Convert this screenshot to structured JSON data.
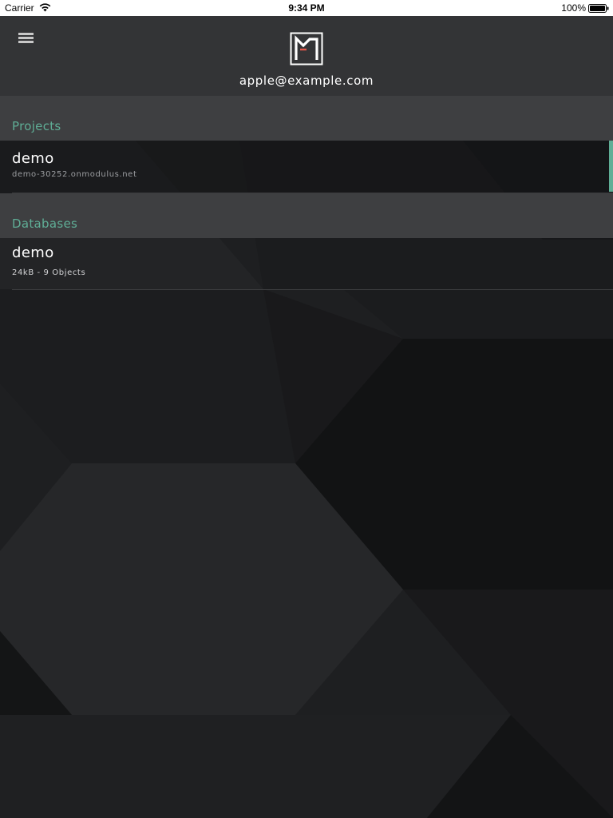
{
  "status_bar": {
    "carrier": "Carrier",
    "time": "9:34 PM",
    "battery": "100%"
  },
  "header": {
    "logo": "modulus-logo",
    "email": "apple@example.com"
  },
  "sections": {
    "projects": {
      "title": "Projects",
      "items": [
        {
          "name": "demo",
          "subtitle": "demo-30252.onmodulus.net",
          "selected": true
        }
      ]
    },
    "databases": {
      "title": "Databases",
      "items": [
        {
          "name": "demo",
          "subtitle": "24kB - 9 Objects"
        }
      ]
    }
  },
  "icons": {
    "menu": "hamburger-menu-icon",
    "wifi": "wifi-icon",
    "battery": "battery-icon"
  },
  "colors": {
    "accent": "#5fae96",
    "header_bg": "#333436",
    "section_bg": "#3e3f41",
    "background": "#1f2022"
  }
}
